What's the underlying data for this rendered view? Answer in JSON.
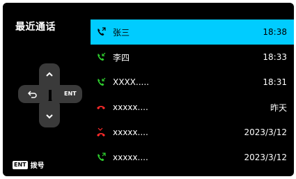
{
  "title": "最近通话",
  "dpad": {
    "ok_label": "ENT"
  },
  "footer": {
    "badge": "ENT",
    "text": "拨号"
  },
  "calls": [
    {
      "name": "张三",
      "time": "18:38",
      "type": "outgoing",
      "color": "#000000",
      "selected": true
    },
    {
      "name": "李四",
      "time": "18:33",
      "type": "incoming",
      "color": "#2fd22f",
      "selected": false
    },
    {
      "name": "XXXX.....",
      "time": "18:31",
      "type": "incoming",
      "color": "#2fd22f",
      "selected": false
    },
    {
      "name": "xxxxx....",
      "time": "昨天",
      "type": "rejected",
      "color": "#ff2a2a",
      "selected": false
    },
    {
      "name": "xxxxx....",
      "time": "2023/3/12",
      "type": "missed",
      "color": "#ff2a2a",
      "selected": false
    },
    {
      "name": "xxxxx....",
      "time": "2023/3/12",
      "type": "outgoing",
      "color": "#2fd22f",
      "selected": false
    }
  ],
  "colors": {
    "accent": "#00ccff",
    "background": "#000000",
    "pad": "#3a3a3a"
  }
}
